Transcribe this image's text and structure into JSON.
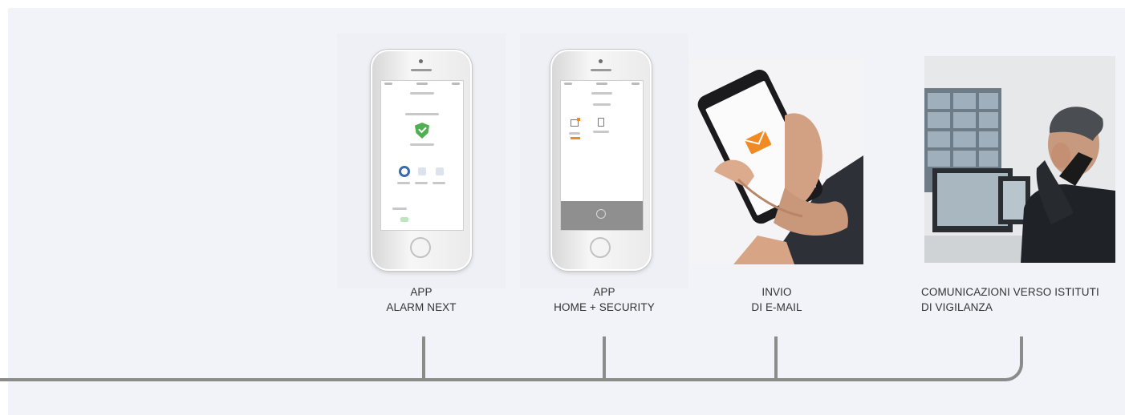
{
  "channels": [
    {
      "line1": "APP",
      "line2": "ALARM NEXT"
    },
    {
      "line1": "APP",
      "line2": "HOME + SECURITY"
    },
    {
      "line1": "INVIO",
      "line2": "DI E-MAIL"
    },
    {
      "line1": "COMUNICAZIONI VERSO ISTITUTI",
      "line2": "DI VIGILANZA"
    }
  ],
  "colors": {
    "line": "#8b8b8b",
    "email_orange": "#f08a24",
    "shield_green": "#4fb04f",
    "panel": "#f1f3f8"
  },
  "icons": [
    "phone-illustration",
    "shield-check-icon",
    "envelope-icon",
    "security-operator-photo"
  ]
}
